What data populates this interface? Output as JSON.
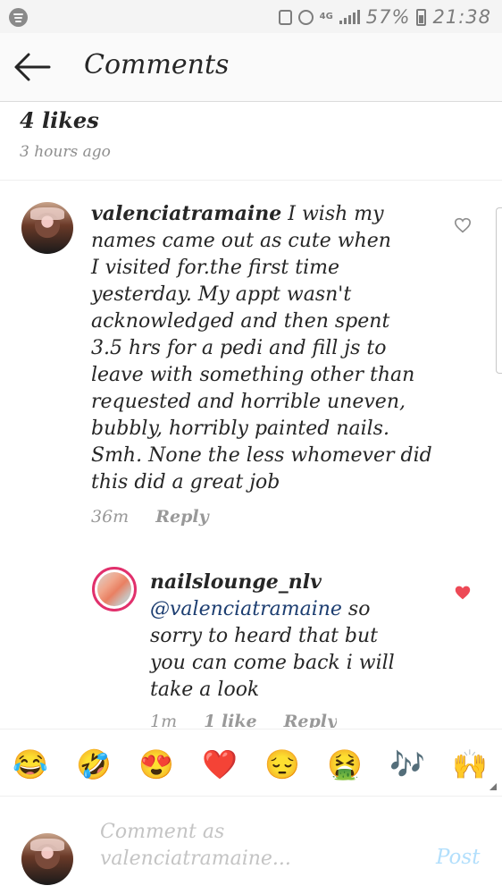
{
  "status_bar": {
    "battery_percent": "57%",
    "time": "21:38",
    "network": "4G"
  },
  "header": {
    "title": "Comments",
    "back_icon": "arrow-left-icon"
  },
  "post": {
    "likes": "4 likes",
    "time_ago": "3 hours ago"
  },
  "comments": [
    {
      "username": "valenciatramaine",
      "text_lines": [
        "I wish my",
        "names came out as cute when",
        "I visited for.the first time",
        "yesterday. My appt wasn't",
        "acknowledged and then spent",
        "3.5 hrs for a pedi and fill js to",
        "leave with something other than",
        "requested and horrible  uneven,",
        "bubbly, horribly painted nails.",
        "Smh. None the less  whomever did",
        "this did a great job"
      ],
      "time": "36m",
      "reply_label": "Reply",
      "liked": false
    },
    {
      "username": "nailslounge_nlv",
      "mention": "@valenciatramaine",
      "text_lines": [
        "so",
        "sorry to heard that but",
        "you can come back i will",
        "take a look"
      ],
      "time": "1m",
      "likes_label": "1 like",
      "reply_label": "Reply",
      "liked": true
    }
  ],
  "emoji_bar": [
    "😂",
    "🤣",
    "😍",
    "❤️",
    "😔",
    "🤮",
    "🎶",
    "🙌"
  ],
  "composer": {
    "placeholder": "Comment as\nvalenciatramaine...",
    "post_label": "Post"
  },
  "colors": {
    "heart_liked": "#ed4956",
    "mention": "#1c3d70",
    "post_button": "#b2dffc",
    "meta_text": "#999999"
  }
}
